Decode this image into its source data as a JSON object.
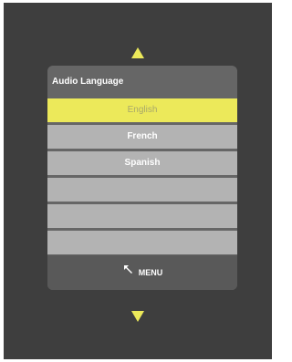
{
  "panel": {
    "title": "Audio Language",
    "items": [
      {
        "label": "English",
        "selected": true
      },
      {
        "label": "French",
        "selected": false
      },
      {
        "label": "Spanish",
        "selected": false
      },
      {
        "label": "",
        "selected": false
      },
      {
        "label": "",
        "selected": false
      },
      {
        "label": "",
        "selected": false
      },
      {
        "label": "",
        "selected": false
      }
    ]
  },
  "footer": {
    "menu_label": "MENU",
    "menu_icon": "return-arrow-icon"
  },
  "navigation": {
    "up_icon": "triangle-up-icon",
    "down_icon": "triangle-down-icon"
  },
  "colors": {
    "highlight": "#ece95a",
    "background": "#3e3e3e",
    "panel": "#666666",
    "item": "#b3b3b3"
  }
}
